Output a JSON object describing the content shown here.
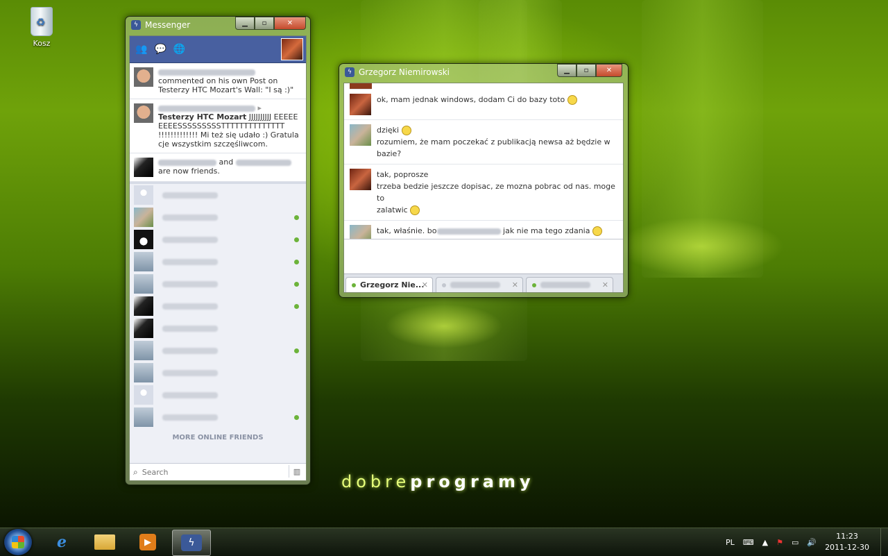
{
  "desktop": {
    "recycle_bin_label": "Kosz",
    "brand_light": "dobre",
    "brand_bold": "programy"
  },
  "messenger": {
    "title": "Messenger",
    "controls": {
      "minimize": "▁",
      "maximize": "▫",
      "close": "✕"
    },
    "toolbar_icons": [
      "friend-requests-icon",
      "messages-icon",
      "notifications-globe-icon"
    ],
    "feed": [
      {
        "avatar": "bald",
        "text": "commented on his own Post on Testerzy HTC Mozart's Wall: \"I są :)\""
      },
      {
        "avatar": "bald",
        "title": "Testerzy HTC Mozart",
        "text": "JJJJJJJJJJ EEEEEEEEESSSSSSSSSTTTTTTTTTTTTTT !!!!!!!!!!!!! Mi też się udało :) Gratulacje wszystkim szczęśliwcom."
      },
      {
        "avatar": "dark",
        "connector": "and",
        "text": "are now friends."
      }
    ],
    "friends": [
      {
        "avatar": "silh",
        "online": false
      },
      {
        "avatar": "man",
        "online": true
      },
      {
        "avatar": "penguin",
        "online": true
      },
      {
        "avatar": "gray",
        "online": true
      },
      {
        "avatar": "gray",
        "online": true
      },
      {
        "avatar": "dark",
        "online": true
      },
      {
        "avatar": "dark",
        "online": false
      },
      {
        "avatar": "gray",
        "online": true
      },
      {
        "avatar": "gray",
        "online": false
      },
      {
        "avatar": "silh",
        "online": false
      },
      {
        "avatar": "gray",
        "online": true
      }
    ],
    "more_online": "MORE ONLINE FRIENDS",
    "search_placeholder": "Search"
  },
  "chat": {
    "title": "Grzegorz Niemirowski",
    "messages": [
      {
        "avatar": "red",
        "lines": [
          "ok, mam jednak windows, dodam Ci do bazy toto"
        ],
        "smiley_after": [
          0
        ]
      },
      {
        "avatar": "man",
        "lines": [
          "dzięki",
          "rozumiem, że mam poczekać z publikacją newsa aż będzie w bazie?"
        ],
        "smiley_after": [
          0
        ]
      },
      {
        "avatar": "red",
        "lines": [
          "tak, poprosze",
          "trzeba bedzie jeszcze dopisac, ze mozna pobrac od nas. moge to",
          "zalatwic"
        ],
        "smiley_after": [
          2
        ]
      },
      {
        "avatar": "man",
        "lines_pre": "tak, właśnie. bo",
        "lines_post": "jak nie ma tego zdania"
      }
    ],
    "tabs": [
      {
        "label": "Grzegorz Nie...",
        "active": true,
        "online": true
      },
      {
        "label": "",
        "active": false,
        "online": false
      },
      {
        "label": "",
        "active": false,
        "online": true
      }
    ],
    "tab_close": "✕"
  },
  "taskbar": {
    "language": "PL",
    "time": "11:23",
    "date": "2011-12-30",
    "pinned": [
      "internet-explorer-icon",
      "windows-explorer-icon",
      "media-player-icon",
      "messenger-icon"
    ]
  },
  "colors": {
    "facebook_blue": "#3b5998",
    "online_green": "#6cb33a",
    "desktop_green": "#6fa20a"
  }
}
